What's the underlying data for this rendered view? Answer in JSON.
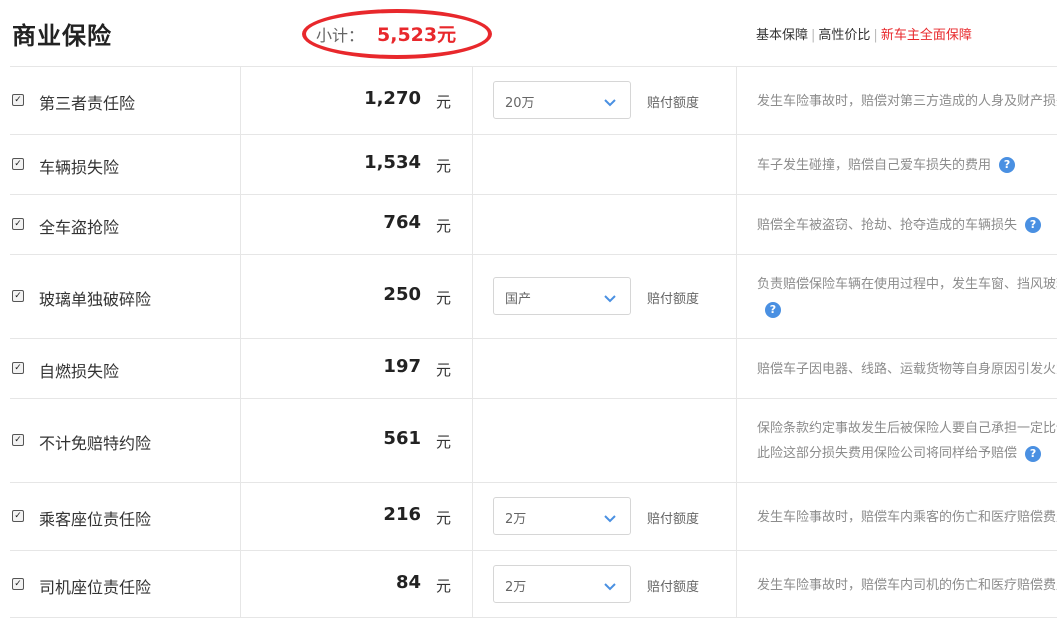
{
  "header": {
    "title": "商业保险",
    "subtotal_label": "小计：",
    "subtotal_value": "5,523元",
    "plans": [
      "基本保障",
      "高性价比",
      "新车主全面保障"
    ]
  },
  "colors": {
    "accent": "#e8282c",
    "help": "#4a90e2"
  },
  "rows": [
    {
      "checked": true,
      "name": "第三者责任险",
      "price": "1,270",
      "unit": "元",
      "select": "20万",
      "select_label": "赔付额度",
      "desc": [
        "发生车险事故时，赔偿对第三方造成的人身及财产损失"
      ]
    },
    {
      "checked": true,
      "name": "车辆损失险",
      "price": "1,534",
      "unit": "元",
      "select": null,
      "select_label": null,
      "desc": [
        "车子发生碰撞，赔偿自己爱车损失的费用"
      ]
    },
    {
      "checked": true,
      "name": "全车盗抢险",
      "price": "764",
      "unit": "元",
      "select": null,
      "select_label": null,
      "desc": [
        "赔偿全车被盗窃、抢劫、抢夺造成的车辆损失"
      ]
    },
    {
      "checked": true,
      "name": "玻璃单独破碎险",
      "price": "250",
      "unit": "元",
      "select": "国产",
      "select_label": "赔付额度",
      "desc": [
        "负责赔偿保险车辆在使用过程中，发生车窗、挡风玻璃的单独破碎",
        ""
      ]
    },
    {
      "checked": true,
      "name": "自燃损失险",
      "price": "197",
      "unit": "元",
      "select": null,
      "select_label": null,
      "desc": [
        "赔偿车子因电器、线路、运载货物等自身原因引发火灾"
      ]
    },
    {
      "checked": true,
      "name": "不计免赔特约险",
      "price": "561",
      "unit": "元",
      "select": null,
      "select_label": null,
      "desc": [
        "保险条款约定事故发生后被保险人要自己承担一定比例的损失",
        "此险这部分损失费用保险公司将同样给予赔偿"
      ]
    },
    {
      "checked": true,
      "name": "乘客座位责任险",
      "price": "216",
      "unit": "元",
      "select": "2万",
      "select_label": "赔付额度",
      "desc": [
        "发生车险事故时，赔偿车内乘客的伤亡和医疗赔偿费用"
      ]
    },
    {
      "checked": true,
      "name": "司机座位责任险",
      "price": "84",
      "unit": "元",
      "select": "2万",
      "select_label": "赔付额度",
      "desc": [
        "发生车险事故时，赔偿车内司机的伤亡和医疗赔偿费用"
      ]
    }
  ],
  "icons": {
    "checkbox": "checkbox-icon",
    "dropdown": "chevron-down-icon",
    "help": "help-icon"
  }
}
